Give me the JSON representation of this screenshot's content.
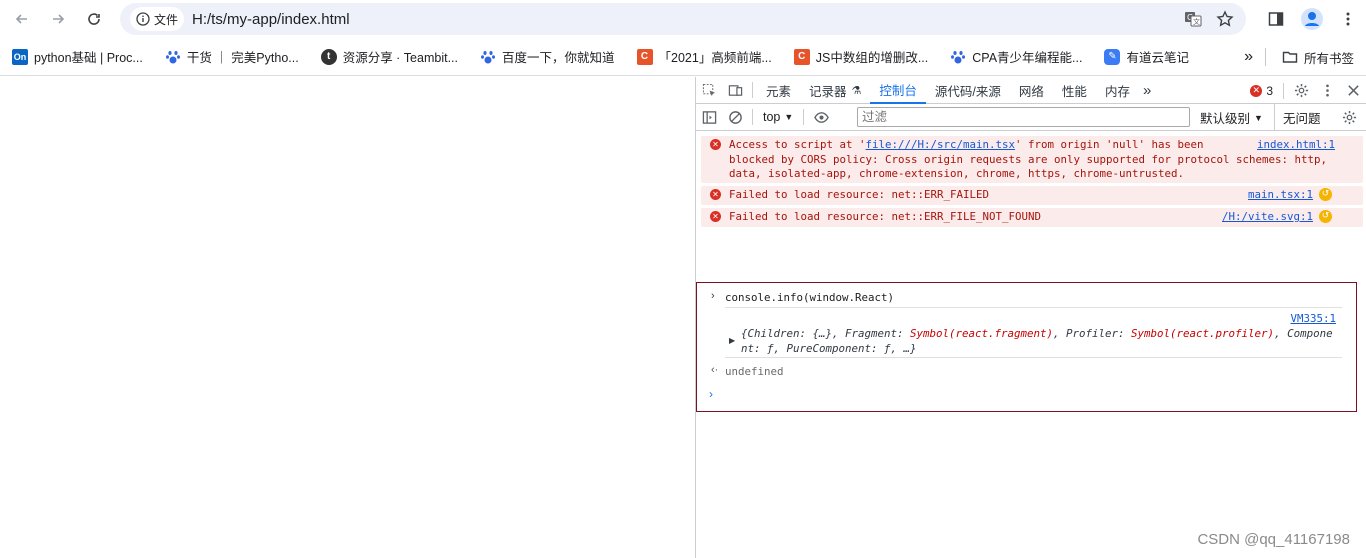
{
  "browser": {
    "site_chip_label": "文件",
    "url": "H:/ts/my-app/index.html"
  },
  "bookmarks": {
    "items": [
      {
        "label": "python基础 | Proc...",
        "icon": "On",
        "color": "#0a66c2"
      },
      {
        "label": "干货 ｜ 完美Pytho...",
        "icon": "paw",
        "color": "#3266e0"
      },
      {
        "label": "资源分享 · Teambit...",
        "icon": "t",
        "color": "#333333"
      },
      {
        "label": "百度一下，你就知道",
        "icon": "paw",
        "color": "#3266e0"
      },
      {
        "label": "「2021」高频前端...",
        "icon": "C",
        "color": "#e8542a"
      },
      {
        "label": "JS中数组的增删改...",
        "icon": "C",
        "color": "#e8542a"
      },
      {
        "label": "CPA青少年编程能...",
        "icon": "paw",
        "color": "#3266e0"
      },
      {
        "label": "有道云笔记",
        "icon": "note",
        "color": "#3b7cf5"
      }
    ],
    "more": "»",
    "all_bookmarks": "所有书签"
  },
  "devtools": {
    "tabs": [
      "元素",
      "记录器",
      "控制台",
      "源代码/来源",
      "网络",
      "性能",
      "内存"
    ],
    "active_tab": "控制台",
    "more_tabs": "»",
    "error_count": "3",
    "context": "top",
    "filter_placeholder": "过滤",
    "level": "默认级别",
    "issues": "无问题"
  },
  "console": {
    "errors": [
      {
        "line1_pre": "Access to script at '",
        "line1_link": "file:///H:/src/main.tsx",
        "line1_post": "' from origin 'null' has been",
        "line2": "blocked by CORS policy: Cross origin requests are only supported for protocol schemes: http,",
        "line3": "data, isolated-app, chrome-extension, chrome, https, chrome-untrusted.",
        "source": "index.html:1"
      },
      {
        "text": "Failed to load resource: net::ERR_FAILED",
        "source": "main.tsx:1"
      },
      {
        "text": "Failed to load resource: net::ERR_FILE_NOT_FOUND",
        "source": "/H:/vite.svg:1"
      }
    ],
    "command": "console.info(window.React)",
    "vm_source": "VM335:1",
    "obj_part1": "{Children: {…}, Fragment: ",
    "obj_sym1": "Symbol(react.fragment)",
    "obj_part2": ", Profiler: ",
    "obj_sym2": "Symbol(react.profiler)",
    "obj_part3": ", Compone",
    "obj_line2": "nt: ƒ, PureComponent: ƒ, …}",
    "result": "undefined"
  },
  "watermark": "CSDN @qq_41167198"
}
